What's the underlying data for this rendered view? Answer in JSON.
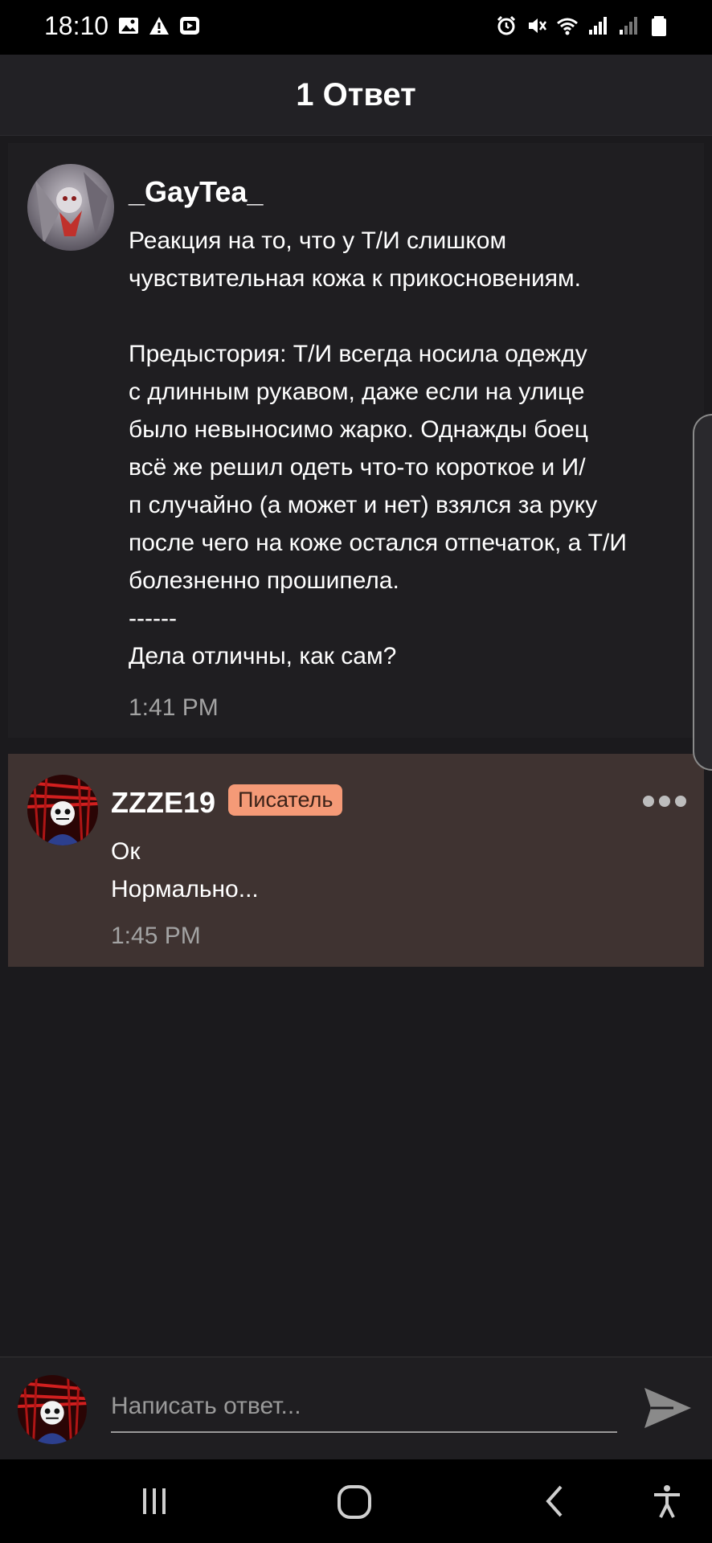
{
  "status_bar": {
    "time": "18:10",
    "left_icons": [
      "image-icon",
      "warning-icon",
      "video-icon"
    ],
    "right_icons": [
      "alarm-icon",
      "mute-icon",
      "wifi-icon",
      "signal-icon",
      "signal-icon-2",
      "battery-icon"
    ]
  },
  "header": {
    "title": "1 Ответ"
  },
  "comments": [
    {
      "author": "_GayTea_",
      "lines": [
        "Реакция на то, что у Т/И слишком",
        "чувствительная кожа к прикосновениям.",
        "",
        "Предыстория: Т/И всегда носила одежду",
        "с длинным рукавом, даже если на улице",
        "было невыносимо жарко. Однажды боец",
        "всё же решил одеть что-то короткое и И/",
        "п случайно (а может и нет) взялся за руку",
        "после чего на коже остался отпечаток, а Т/И",
        "болезненно прошипела.",
        "------",
        "Дела отличны, как сам?"
      ],
      "time": "1:41 PM"
    },
    {
      "author": "ZZZE19",
      "badge": "Писатель",
      "lines": [
        "Ок",
        "Нормально..."
      ],
      "time": "1:45 PM"
    }
  ],
  "reply": {
    "placeholder": "Написать ответ..."
  },
  "colors": {
    "background": "#1b1a1d",
    "header": "#222125",
    "highlight_comment": "#3f3331",
    "badge": "#f59a77"
  },
  "navbar": {
    "icons": [
      "recents-icon",
      "home-icon",
      "back-icon",
      "accessibility-icon"
    ]
  }
}
